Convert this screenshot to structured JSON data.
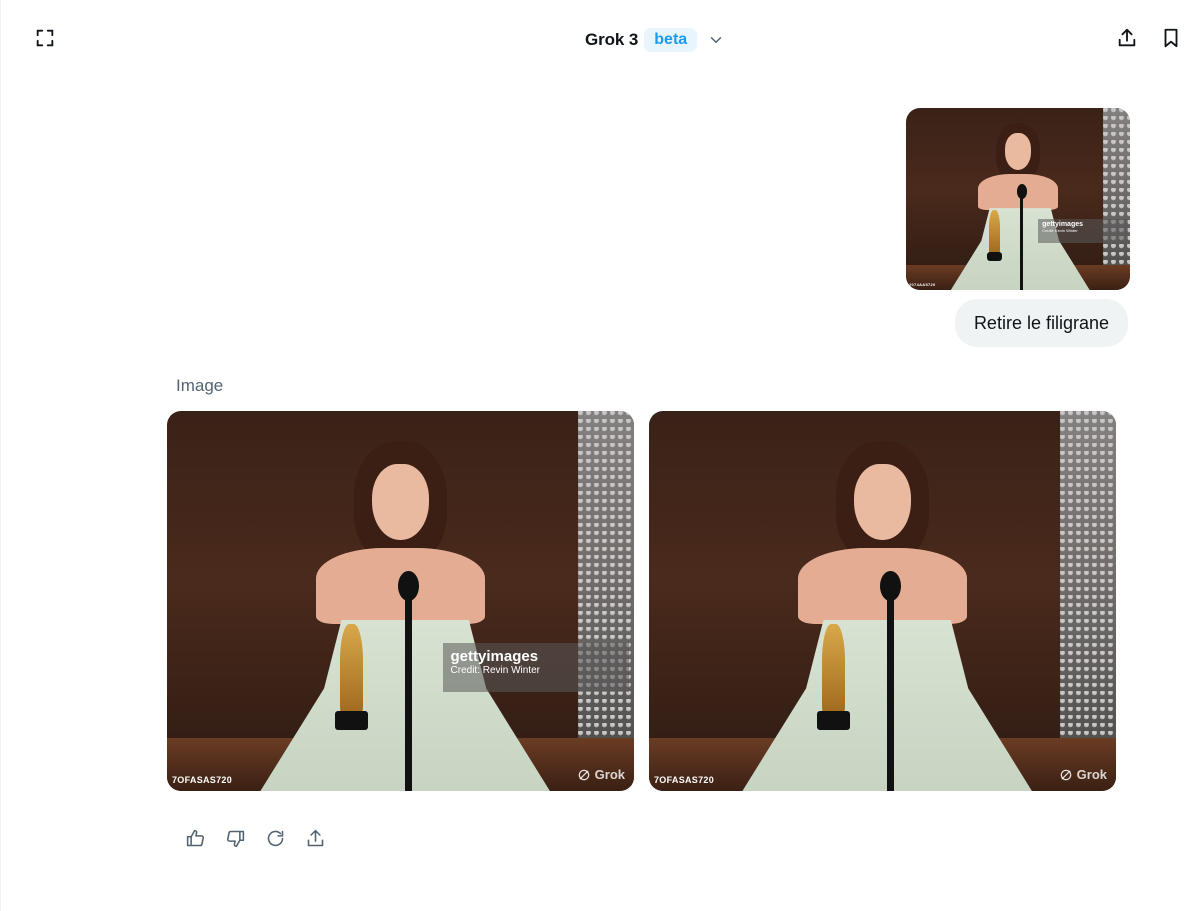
{
  "header": {
    "title": "Grok 3",
    "badge": "beta",
    "icons": [
      "expand-icon",
      "chevron-down-icon",
      "share-icon",
      "bookmark-icon"
    ]
  },
  "user_message": {
    "text": "Retire le filigrane",
    "image": {
      "watermark_brand": "gettyimages",
      "watermark_credit": "Credit: Kevin Winter",
      "code": "2074AA5720"
    }
  },
  "assistant": {
    "label": "Image",
    "images": [
      {
        "watermark_brand": "gettyimages",
        "watermark_credit": "Credit: Revin Winter",
        "code": "7OFASAS720",
        "grok_watermark": "Grok"
      },
      {
        "code": "7OFASAS720",
        "grok_watermark": "Grok"
      }
    ],
    "actions": [
      "thumbs-up-icon",
      "thumbs-down-icon",
      "regenerate-icon",
      "share-icon"
    ]
  },
  "colors": {
    "accent": "#1d9bf0",
    "badge_bg": "#e8f5fd",
    "bubble_bg": "#eff3f4",
    "muted_text": "#536471",
    "text": "#0f1419"
  }
}
